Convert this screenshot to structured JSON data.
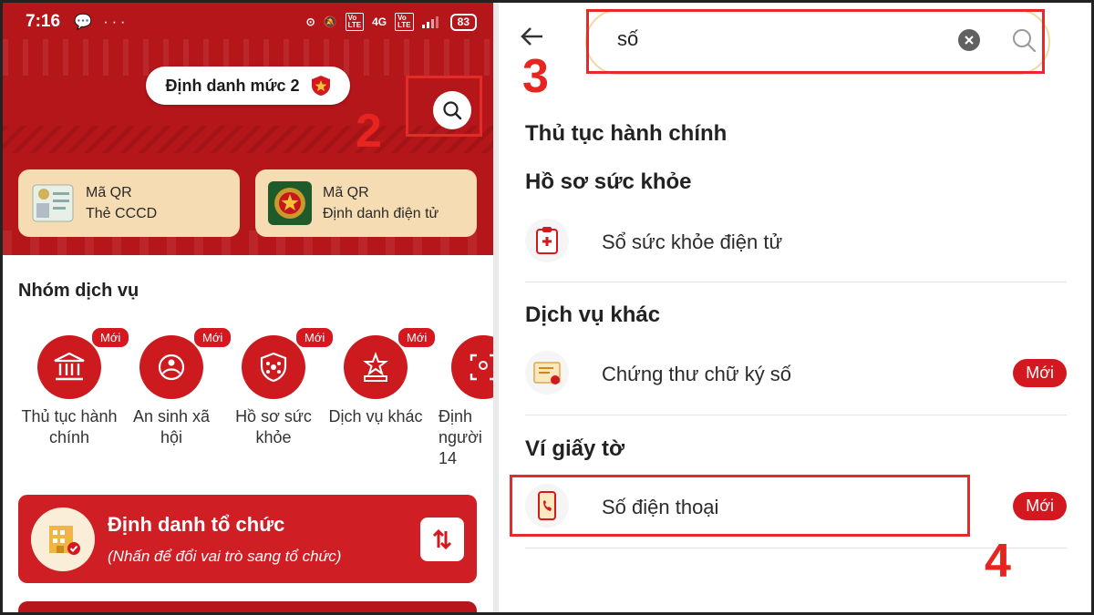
{
  "status_bar": {
    "time": "7:16",
    "left_icons": "💬 ···",
    "signal": "4G",
    "battery": "83"
  },
  "header": {
    "level_label": "Định danh mức 2",
    "search_icon": "search-icon"
  },
  "qr_cards": [
    {
      "line1": "Mã QR",
      "line2": "Thẻ CCCD"
    },
    {
      "line1": "Mã QR",
      "line2": "Định danh điện tử"
    }
  ],
  "services": {
    "title": "Nhóm dịch vụ",
    "items": [
      {
        "badge": "Mới",
        "label": "Thủ tục hành chính",
        "icon": "bank-icon"
      },
      {
        "badge": "Mới",
        "label": "An sinh xã hội",
        "icon": "social-care-icon"
      },
      {
        "badge": "Mới",
        "label": "Hồ sơ sức khỏe",
        "icon": "health-shield-icon"
      },
      {
        "badge": "Mới",
        "label": "Dịch vụ khác",
        "icon": "star-podium-icon"
      },
      {
        "badge": "",
        "label": "Định người 14",
        "icon": "id-scan-icon"
      }
    ]
  },
  "org_card": {
    "title": "Định danh tổ chức",
    "subtitle": "(Nhấn để đổi vai trò sang tổ chức)"
  },
  "search": {
    "query": "số"
  },
  "results": {
    "cat1": "Thủ tục hành chính",
    "cat2": "Hồ sơ sức khỏe",
    "item_health": "Sổ sức khỏe điện tử",
    "cat3": "Dịch vụ khác",
    "item_cert": "Chứng thư chữ ký số",
    "item_cert_badge": "Mới",
    "cat4": "Ví giấy tờ",
    "item_phone": "Số điện thoại",
    "item_phone_badge": "Mới"
  },
  "annotations": {
    "step2": "2",
    "step3": "3",
    "step4": "4"
  },
  "colors": {
    "brand_red": "#cc1a1f",
    "highlight_red": "#e52a2a",
    "card_beige": "#f6dcb3"
  }
}
